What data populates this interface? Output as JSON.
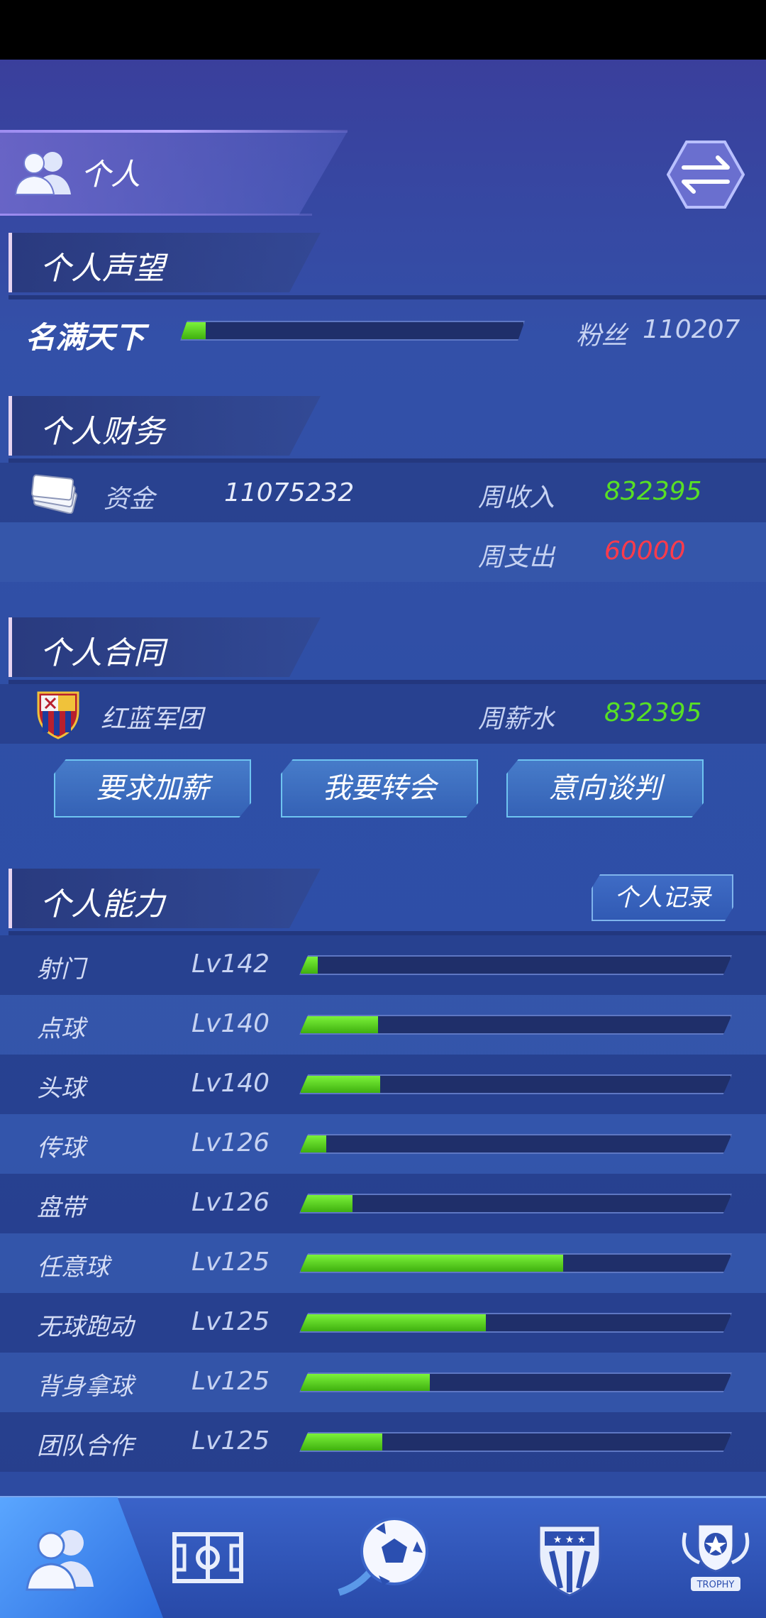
{
  "header": {
    "title": "个人",
    "swap_icon": "swap-arrows-icon"
  },
  "reputation": {
    "section_title": "个人声望",
    "rank_label": "名满天下",
    "progress": 0.07,
    "fans_label": "粉丝",
    "fans_value": "110207"
  },
  "finance": {
    "section_title": "个人财务",
    "funds_label": "资金",
    "funds_value": "11075232",
    "weekly_income_label": "周收入",
    "weekly_income_value": "832395",
    "weekly_expense_label": "周支出",
    "weekly_expense_value": "60000"
  },
  "contract": {
    "section_title": "个人合同",
    "club_name": "红蓝军团",
    "salary_label": "周薪水",
    "salary_value": "832395",
    "buttons": [
      "要求加薪",
      "我要转会",
      "意向谈判"
    ]
  },
  "ability": {
    "section_title": "个人能力",
    "record_button": "个人记录",
    "skills": [
      {
        "name": "射门",
        "level": "Lv142",
        "progress": 0.04
      },
      {
        "name": "点球",
        "level": "Lv140",
        "progress": 0.18
      },
      {
        "name": "头球",
        "level": "Lv140",
        "progress": 0.185
      },
      {
        "name": "传球",
        "level": "Lv126",
        "progress": 0.06
      },
      {
        "name": "盘带",
        "level": "Lv126",
        "progress": 0.12
      },
      {
        "name": "任意球",
        "level": "Lv125",
        "progress": 0.61
      },
      {
        "name": "无球跑动",
        "level": "Lv125",
        "progress": 0.43
      },
      {
        "name": "背身拿球",
        "level": "Lv125",
        "progress": 0.3
      },
      {
        "name": "团队合作",
        "level": "Lv125",
        "progress": 0.19
      }
    ]
  },
  "colors": {
    "green": "#58e024",
    "red": "#ff3b4b",
    "accent": "#6fc4f0"
  },
  "bottom_nav": {
    "items": [
      "players-icon",
      "pitch-icon",
      "football-icon",
      "club-badge-icon",
      "trophy-icon"
    ],
    "trophy_text": "TROPHY"
  }
}
